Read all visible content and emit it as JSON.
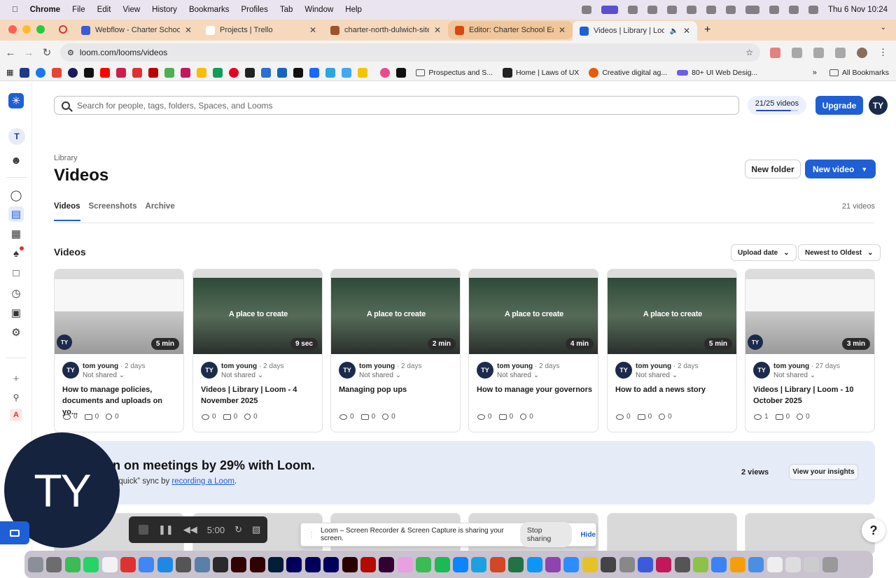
{
  "menubar": {
    "items": [
      "Chrome",
      "File",
      "Edit",
      "View",
      "History",
      "Bookmarks",
      "Profiles",
      "Tab",
      "Window",
      "Help"
    ],
    "clock": "Thu 6 Nov  10:24"
  },
  "tabs": [
    {
      "title": "Webflow - Charter School No",
      "color": "#3b5bdb"
    },
    {
      "title": "Projects | Trello",
      "color": "#fff"
    },
    {
      "title": "charter-north-dulwich-sitem",
      "color": "#a0522d"
    },
    {
      "title": "Editor: Charter School East D",
      "color": "#d9480f"
    },
    {
      "title": "Videos | Library | Loom",
      "color": "#1e5fd6"
    }
  ],
  "address": "loom.com/looms/videos",
  "bookmarks": {
    "folders": [
      "Prospectus and S...",
      "Home | Laws of UX",
      "Creative digital ag...",
      "80+ UI Web Desig..."
    ],
    "all": "All Bookmarks"
  },
  "search": {
    "placeholder": "Search for people, tags, folders, Spaces, and Looms"
  },
  "quota": {
    "label": "21/25 videos",
    "used": 21,
    "total": 25
  },
  "upgrade": "Upgrade",
  "user_initials": "TY",
  "breadcrumb": "Library",
  "page_title": "Videos",
  "new_folder": "New folder",
  "new_video": "New video",
  "subtabs": [
    "Videos",
    "Screenshots",
    "Archive"
  ],
  "video_count": "21 videos",
  "section_title": "Videos",
  "filters": {
    "date": "Upload date",
    "sort": "Newest to Oldest"
  },
  "cards": [
    {
      "duration": "5 min",
      "owner": "tom young",
      "age": "· 2 days",
      "share": "Not shared",
      "title": "How to manage policies, documents and uploads on yo...",
      "views": "0",
      "comments": "0",
      "reactions": "0",
      "promo": ""
    },
    {
      "duration": "9 sec",
      "owner": "tom young",
      "age": "· 2 days",
      "share": "Not shared",
      "title": "Videos | Library | Loom - 4 November 2025",
      "views": "0",
      "comments": "0",
      "reactions": "0",
      "promo": "A place to create"
    },
    {
      "duration": "2 min",
      "owner": "tom young",
      "age": "· 2 days",
      "share": "Not shared",
      "title": "Managing pop ups",
      "views": "0",
      "comments": "0",
      "reactions": "0",
      "promo": "A place to create"
    },
    {
      "duration": "4 min",
      "owner": "tom young",
      "age": "· 2 days",
      "share": "Not shared",
      "title": "How to manage your governors",
      "views": "0",
      "comments": "0",
      "reactions": "0",
      "promo": "A place to create"
    },
    {
      "duration": "5 min",
      "owner": "tom young",
      "age": "· 2 days",
      "share": "Not shared",
      "title": "How to add a news story",
      "views": "0",
      "comments": "0",
      "reactions": "0",
      "promo": "A place to create"
    },
    {
      "duration": "3 min",
      "owner": "tom young",
      "age": "· 27 days",
      "share": "Not shared",
      "title": "Videos | Library | Loom - 10 October 2025",
      "views": "1",
      "comments": "0",
      "reactions": "0",
      "promo": ""
    }
  ],
  "banner": {
    "headline": "wn on meetings by 29% with Loom.",
    "sub_pre": "ext “quick” sync by ",
    "sub_link": "recording a Loom",
    "sub_post": ".",
    "views": "2 views",
    "cta": "View your insights"
  },
  "camera_initials": "TY",
  "recorder": {
    "time": "5:00"
  },
  "share_notice": {
    "text": "Loom – Screen Recorder & Screen Capture is sharing your screen.",
    "stop": "Stop sharing",
    "hide": "Hide"
  },
  "help": "?",
  "rail_letter": "A",
  "workspace_letter": "T"
}
